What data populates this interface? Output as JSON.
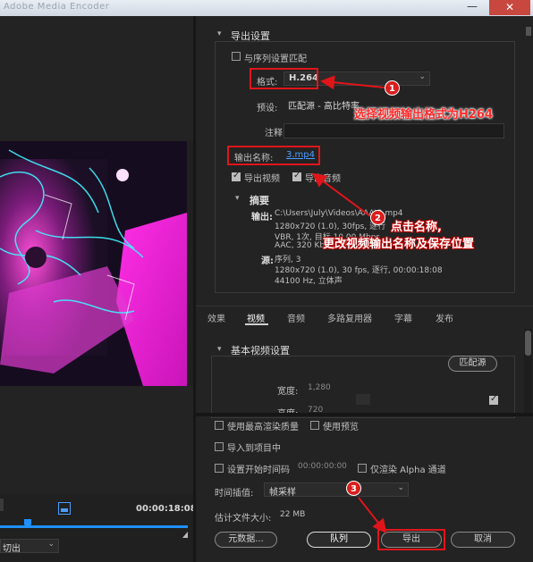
{
  "window": {
    "title_faded": "Adobe Media Encoder",
    "minimize_glyph": "—",
    "close_glyph": "✕"
  },
  "export_settings": {
    "section_title": "导出设置",
    "match_sequence_label": "与序列设置匹配",
    "format_label": "格式:",
    "format_value": "H.264",
    "preset_label": "预设:",
    "preset_value": "匹配源 - 高比特率",
    "comment_label": "注释:",
    "output_name_label": "输出名称:",
    "output_name_value": "3.mp4",
    "export_video_label": "导出视频",
    "export_audio_label": "导出音频"
  },
  "summary": {
    "title": "摘要",
    "output_label": "输出:",
    "output_line1": "C:\\Users\\July\\Videos\\AAA\\3.mp4",
    "output_line2": "1280x720 (1.0), 30fps, 逐行",
    "output_line3": "VBR, 1次, 目标 10.00 Mbps",
    "output_line4": "AAC, 320 Kbps, 48 kHz",
    "source_label": "源:",
    "source_line1": "序列, 3",
    "source_line2": "1280x720 (1.0), 30 fps, 逐行, 00:00:18:08",
    "source_line3": "44100 Hz, 立体声"
  },
  "tabs": [
    {
      "label": "效果"
    },
    {
      "label": "视频"
    },
    {
      "label": "音频"
    },
    {
      "label": "多路复用器"
    },
    {
      "label": "字幕"
    },
    {
      "label": "发布"
    }
  ],
  "video_settings": {
    "section_title": "基本视频设置",
    "match_source_button": "匹配源",
    "width_label": "宽度:",
    "width_value": "1,280",
    "height_label": "高度:",
    "height_value": "720"
  },
  "bottom_options": {
    "max_render_quality": "使用最高渲染质量",
    "use_previews": "使用预览",
    "import_into_project": "导入到项目中",
    "set_start_timecode": "设置开始时间码",
    "start_timecode_value": "00:00:00:00",
    "render_alpha_only": "仅渲染 Alpha 通道",
    "time_interpolation_label": "时间插值:",
    "time_interpolation_value": "帧采样",
    "estimated_size_label": "估计文件大小:",
    "estimated_size_value": "22 MB"
  },
  "buttons": {
    "metadata": "元数据...",
    "queue": "队列",
    "export": "导出",
    "cancel": "取消"
  },
  "timeline": {
    "timecode": "00:00:18:08",
    "cut_select_value": "切出"
  },
  "annotations": {
    "step1_badge": "1",
    "step1_text": "选择视频输出格式为H264",
    "step2_badge": "2",
    "step2_text_line1": "点击名称,",
    "step2_text_line2": "更改视频输出名称及保存位置",
    "step3_badge": "3"
  },
  "colors": {
    "annotation_red": "#e0151a",
    "link_blue": "#4a9dff",
    "playhead_blue": "#1e90ff"
  }
}
